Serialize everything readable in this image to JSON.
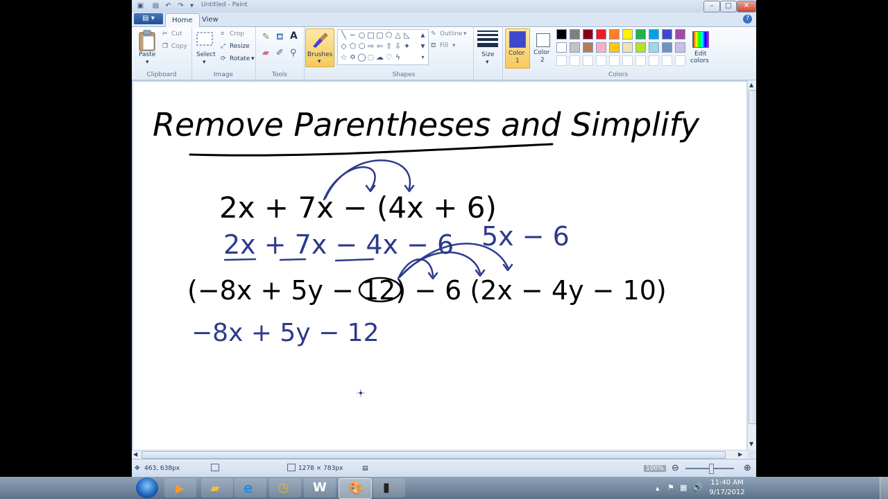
{
  "window": {
    "title": "Untitled - Paint"
  },
  "tabs": [
    {
      "label": "Home"
    },
    {
      "label": "View"
    }
  ],
  "clipboard": {
    "paste": "Paste",
    "cut": "Cut",
    "copy": "Copy",
    "label": "Clipboard"
  },
  "image": {
    "select": "Select",
    "crop": "Crop",
    "resize": "Resize",
    "rotate": "Rotate",
    "label": "Image"
  },
  "tools": {
    "label": "Tools"
  },
  "brushes": {
    "label": "Brushes"
  },
  "shapes": {
    "outline": "Outline",
    "fill": "Fill",
    "label": "Shapes"
  },
  "size": {
    "label": "Size"
  },
  "colors": {
    "color1_l1": "Color",
    "color1_l2": "1",
    "color2_l1": "Color",
    "color2_l2": "2",
    "edit_l1": "Edit",
    "edit_l2": "colors",
    "label": "Colors",
    "color1_hex": "#3f48cc",
    "color2_hex": "#ffffff",
    "palette": [
      "#000000",
      "#7f7f7f",
      "#880015",
      "#ed1c24",
      "#ff7f27",
      "#fff200",
      "#22b14c",
      "#00a2e8",
      "#3f48cc",
      "#a349a4",
      "#ffffff",
      "#c3c3c3",
      "#b97a57",
      "#ffaec9",
      "#ffc90e",
      "#efe4b0",
      "#b5e61d",
      "#99d9ea",
      "#7092be",
      "#c8bfe7"
    ]
  },
  "canvas": {
    "title": "Remove Parentheses and Simplify",
    "expr1": "2x + 7x − (4x + 6)",
    "expr1_work": "2x + 7x − 4x − 6",
    "expr1_result": "5x − 6",
    "expr2": "(−8x + 5y − 12) − 6 (2x − 4y − 10)",
    "expr2_work": "−8x + 5y − 12"
  },
  "status": {
    "cursor": "463, 638px",
    "size": "1278 × 783px",
    "zoom": "100%"
  },
  "taskbar": {
    "time": "11:40 AM",
    "date": "9/17/2012"
  }
}
